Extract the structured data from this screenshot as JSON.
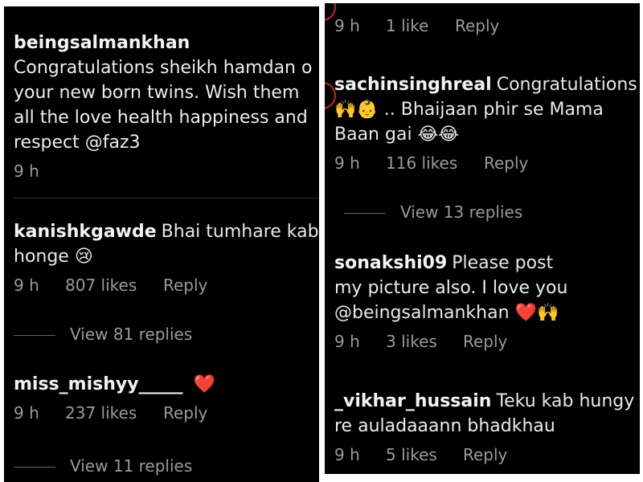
{
  "left": {
    "comments": [
      {
        "user": "beingsalmankhan",
        "lines": [
          "Congratulations sheikh hamdan o",
          "your new born twins. Wish them",
          "all the love health happiness and",
          "respect @faz3"
        ],
        "time": "9 h"
      },
      {
        "user": "kanishkgawde",
        "lines_first": "Bhai tumhare kab",
        "lines_second": "honge",
        "emoji": "😢",
        "time": "9 h",
        "likes": "807 likes",
        "reply": "Reply",
        "view_replies": "View 81 replies"
      },
      {
        "user": "miss_mishyy_____",
        "emoji": "❤️",
        "time": "9 h",
        "likes": "237 likes",
        "reply": "Reply",
        "view_replies": "View 11 replies"
      }
    ]
  },
  "right": {
    "top_meta": {
      "time": "9 h",
      "likes": "1 like",
      "reply": "Reply"
    },
    "comments": [
      {
        "user": "sachinsinghreal",
        "line1": "Congratulations",
        "line2_emoji": "🙌👶",
        "line2": ".. Bhaijaan phir se Mama",
        "line3": "Baan gai",
        "line3_emoji": "😂😂",
        "time": "9 h",
        "likes": "116 likes",
        "reply": "Reply",
        "view_replies": "View 13 replies"
      },
      {
        "user": "sonakshi09",
        "line1": "Please post",
        "line2": "my picture also. I love you",
        "line3": "@beingsalmankhan",
        "line3_emoji": "❤️🙌",
        "time": "9 h",
        "likes": "3 likes",
        "reply": "Reply"
      },
      {
        "user": "_vikhar_hussain",
        "line1": "Teku kab hungy",
        "line2": "re auladaaann bhadkhau",
        "time": "9 h",
        "likes": "5 likes",
        "reply": "Reply"
      }
    ]
  }
}
